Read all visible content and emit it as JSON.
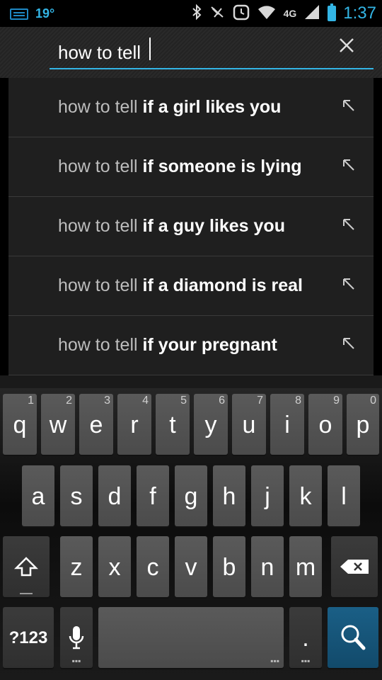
{
  "status_bar": {
    "temperature": "19°",
    "network": "4G",
    "time": "1:37",
    "icons": [
      "keyboard-icon",
      "bluetooth-icon",
      "vibrate-icon",
      "alarm-icon",
      "wifi-icon",
      "signal-icon",
      "battery-icon"
    ]
  },
  "search": {
    "query": "how to tell",
    "clear_icon": "close-icon"
  },
  "suggestions": [
    {
      "prefix": "how to tell",
      "suffix": "if a girl likes you"
    },
    {
      "prefix": "how to tell",
      "suffix": "if someone is lying"
    },
    {
      "prefix": "how to tell",
      "suffix": "if a guy likes you"
    },
    {
      "prefix": "how to tell",
      "suffix": "if a diamond is real"
    },
    {
      "prefix": "how to tell",
      "suffix": "if your pregnant"
    }
  ],
  "keyboard": {
    "row1": [
      {
        "key": "q",
        "hint": "1"
      },
      {
        "key": "w",
        "hint": "2"
      },
      {
        "key": "e",
        "hint": "3"
      },
      {
        "key": "r",
        "hint": "4"
      },
      {
        "key": "t",
        "hint": "5"
      },
      {
        "key": "y",
        "hint": "6"
      },
      {
        "key": "u",
        "hint": "7"
      },
      {
        "key": "i",
        "hint": "8"
      },
      {
        "key": "o",
        "hint": "9"
      },
      {
        "key": "p",
        "hint": "0"
      }
    ],
    "row2": [
      "a",
      "s",
      "d",
      "f",
      "g",
      "h",
      "j",
      "k",
      "l"
    ],
    "row3": [
      "z",
      "x",
      "c",
      "v",
      "b",
      "n",
      "m"
    ],
    "symbols_label": "?123",
    "period_label": ".",
    "accent_color": "#33b5e5"
  }
}
